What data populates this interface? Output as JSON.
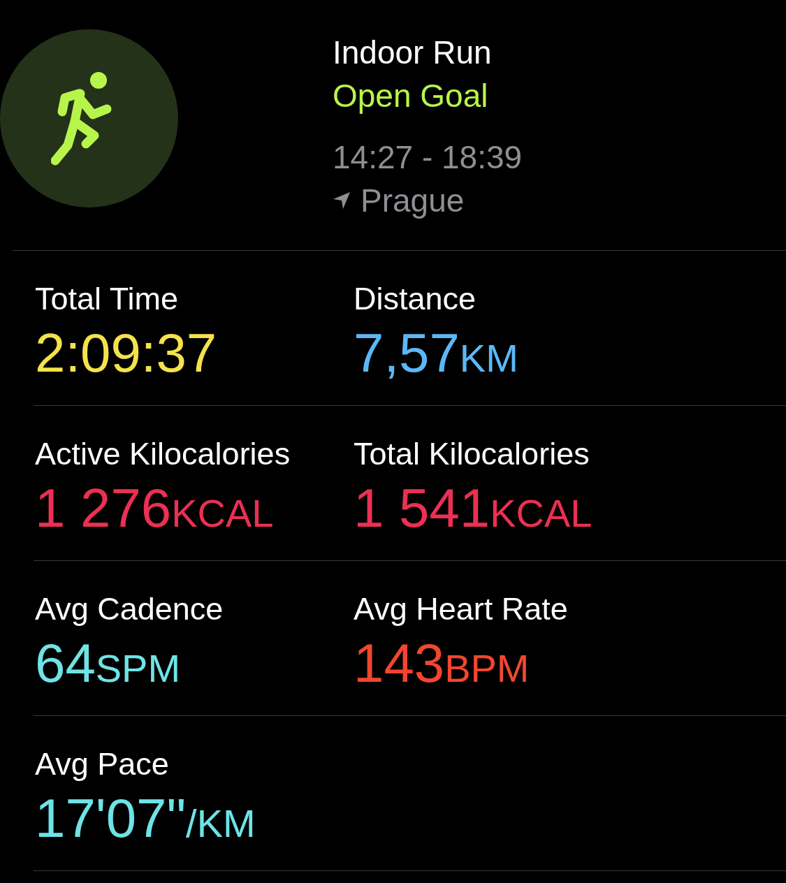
{
  "header": {
    "title": "Indoor Run",
    "goal": "Open Goal",
    "time_range": "14:27 - 18:39",
    "location": "Prague"
  },
  "metrics": [
    {
      "label": "Total Time",
      "value": "2:09:37",
      "color": "#f4e24c"
    },
    {
      "label": "Distance",
      "value": "7,57",
      "unit": "KM",
      "color": "#5bb8f6"
    },
    {
      "label": "Active Kilocalories",
      "value": "1 276",
      "unit": "KCAL",
      "color": "#ea3053"
    },
    {
      "label": "Total Kilocalories",
      "value": "1 541",
      "unit": "KCAL",
      "color": "#ea3053"
    },
    {
      "label": "Avg Cadence",
      "value": "64",
      "unit": "SPM",
      "color": "#6fe3e6"
    },
    {
      "label": "Avg Heart Rate",
      "value": "143",
      "unit": "BPM",
      "color": "#f2462f"
    },
    {
      "label": "Avg Pace",
      "value": "17'07\"",
      "unit": "/KM",
      "color": "#6fe3e6"
    }
  ]
}
